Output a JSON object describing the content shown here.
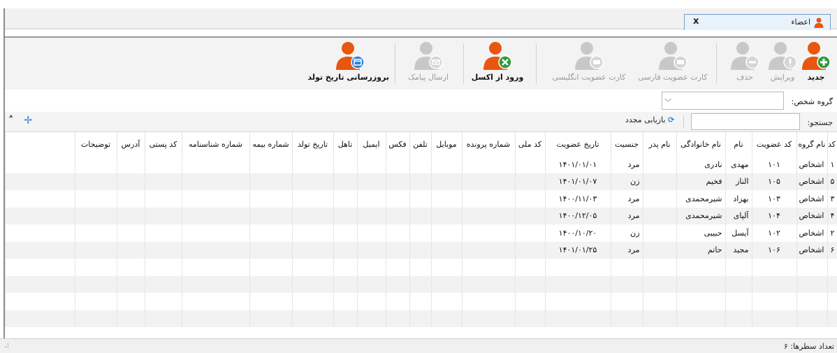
{
  "tab": {
    "label": "اعضاء",
    "close": "x",
    "icon": "person-icon"
  },
  "toolbar": {
    "new": "جدید",
    "edit": "ویرایش",
    "delete": "حذف",
    "persian_card": "کارت عضویت فارسی",
    "english_card": "کارت عضویت انگلیسی",
    "import_excel": "ورود از اکسل",
    "send_sms": "ارسال پیامک",
    "update_birthday": "بروزرسانی تاریخ تولد"
  },
  "filters": {
    "group_label": "گروه شخص:",
    "group_value": "",
    "search_label": "جستجو:",
    "search_value": "",
    "reset_label": "بازیابی مجدد"
  },
  "table": {
    "columns": [
      "کد",
      "نام گروه",
      "کد عضویت",
      "نام",
      "نام خانوادگی",
      "نام پدر",
      "جنسیت",
      "تاریخ عضویت",
      "کد ملی",
      "شماره پرونده",
      "موبایل",
      "تلفن",
      "فکس",
      "ایمیل",
      "تاهل",
      "تاریخ تولد",
      "شماره بیمه",
      "شماره شناسنامه",
      "کد پستی",
      "آدرس",
      "توضیحات"
    ],
    "rows": [
      [
        "۱",
        "اشخاص",
        "۱۰۱",
        "مهدی",
        "نادری",
        "",
        "مرد",
        "۱۴۰۱/۰۱/۰۱",
        "",
        "",
        "",
        "",
        "",
        "",
        "",
        "",
        "",
        "",
        "",
        "",
        ""
      ],
      [
        "۵",
        "اشخاص",
        "۱۰۵",
        "الناز",
        "فخیم",
        "",
        "زن",
        "۱۴۰۱/۰۱/۰۷",
        "",
        "",
        "",
        "",
        "",
        "",
        "",
        "",
        "",
        "",
        "",
        "",
        ""
      ],
      [
        "۳",
        "اشخاص",
        "۱۰۳",
        "بهزاد",
        "شیرمحمدی",
        "",
        "مرد",
        "۱۴۰۰/۱۱/۰۳",
        "",
        "",
        "",
        "",
        "",
        "",
        "",
        "",
        "",
        "",
        "",
        "",
        ""
      ],
      [
        "۴",
        "اشخاص",
        "۱۰۴",
        "آلپای",
        "شیرمحمدی",
        "",
        "مرد",
        "۱۴۰۰/۱۲/۰۵",
        "",
        "",
        "",
        "",
        "",
        "",
        "",
        "",
        "",
        "",
        "",
        "",
        ""
      ],
      [
        "۲",
        "اشخاص",
        "۱۰۲",
        "آیسل",
        "حبیبی",
        "",
        "زن",
        "۱۴۰۰/۱۰/۲۰",
        "",
        "",
        "",
        "",
        "",
        "",
        "",
        "",
        "",
        "",
        "",
        "",
        ""
      ],
      [
        "۶",
        "اشخاص",
        "۱۰۶",
        "مجید",
        "حاتم",
        "",
        "مرد",
        "۱۴۰۱/۰۱/۲۵",
        "",
        "",
        "",
        "",
        "",
        "",
        "",
        "",
        "",
        "",
        "",
        "",
        ""
      ]
    ]
  },
  "status": {
    "row_count_label": "تعداد سطرها:",
    "row_count": "۶",
    "grip": ":."
  },
  "colors": {
    "accent_orange": "#e8560f",
    "green": "#2f9b3a",
    "blue": "#2f7fd8",
    "disabled_gray": "#c8c8c8"
  }
}
